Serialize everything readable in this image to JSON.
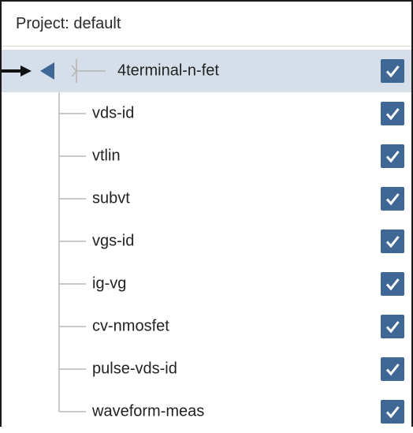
{
  "project": {
    "title": "Project: default"
  },
  "tree": {
    "root": {
      "label": "4terminal-n-fet",
      "checked": true,
      "expanded": true
    },
    "children": [
      {
        "label": "vds-id",
        "checked": true
      },
      {
        "label": "vtlin",
        "checked": true
      },
      {
        "label": "subvt",
        "checked": true
      },
      {
        "label": "vgs-id",
        "checked": true
      },
      {
        "label": "ig-vg",
        "checked": true
      },
      {
        "label": "cv-nmosfet",
        "checked": true
      },
      {
        "label": "pulse-vds-id",
        "checked": true
      },
      {
        "label": "waveform-meas",
        "checked": true
      }
    ]
  },
  "colors": {
    "selected_row": "#d6dfe9",
    "checkbox_fill": "#3f6796",
    "collapse_triangle": "#3f6796"
  },
  "icons": {
    "pointer": "arrow-right-icon",
    "collapse": "triangle-left-icon",
    "node": "tree-branch-icon",
    "check": "checkmark-icon"
  }
}
